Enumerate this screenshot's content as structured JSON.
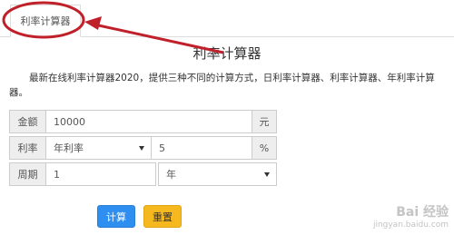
{
  "tabs": [
    {
      "label": "利率计算器"
    }
  ],
  "page": {
    "title": "利率计算器",
    "description": "最新在线利率计算器2020，提供三种不同的计算方式，日利率计算器、利率计算器、年利率计算器。"
  },
  "form": {
    "amount": {
      "label": "金额",
      "value": "10000",
      "unit": "元"
    },
    "rate": {
      "label": "利率",
      "type_selected": "年利率",
      "value": "5",
      "unit": "%"
    },
    "period": {
      "label": "周期",
      "value": "1",
      "unit_selected": "年"
    }
  },
  "buttons": {
    "calculate": "计算",
    "reset": "重置"
  },
  "watermark": {
    "brand": "Bai 经验",
    "site": "jingyan.baidu.com"
  },
  "colors": {
    "annotation": "#c0202a",
    "primary_button": "#2e8ff0",
    "warning_button": "#f5b81f"
  }
}
